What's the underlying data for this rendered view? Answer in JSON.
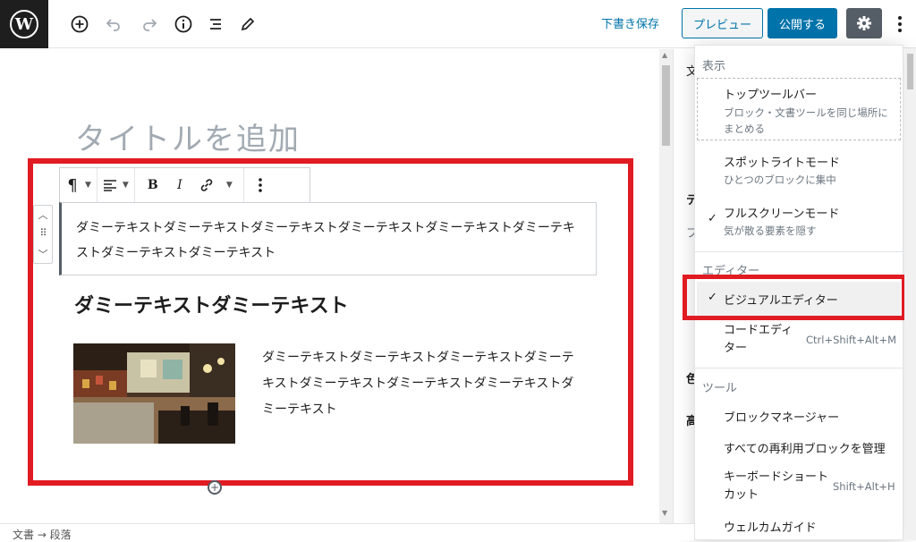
{
  "toolbar": {
    "save_draft": "下書き保存",
    "preview": "プレビュー",
    "publish": "公開する",
    "icons": [
      "wordpress-logo",
      "add-block-icon",
      "undo-icon",
      "redo-icon",
      "info-icon",
      "list-view-icon",
      "edit-tool-icon",
      "gear-icon",
      "more-vertical-icon"
    ]
  },
  "editor": {
    "title_placeholder": "タイトルを追加",
    "paragraph_text": "ダミーテキストダミーテキストダミーテキストダミーテキストダミーテキストダミーテキストダミーテキストダミーテキスト",
    "heading_text": "ダミーテキストダミーテキスト",
    "media_text": "ダミーテキストダミーテキストダミーテキストダミーテキストダミーテキストダミーテキストダミーテキストダミーテキスト",
    "block_toolbar": {
      "paragraph": "¶",
      "bold": "B",
      "italic": "I"
    }
  },
  "sidebar_fragments": {
    "tab_char": "文",
    "row1": "テ",
    "row2": "フ",
    "row3": "色",
    "row4": "高"
  },
  "menu": {
    "view_label": "表示",
    "top_toolbar_title": "トップツールバー",
    "top_toolbar_desc": "ブロック・文書ツールを同じ場所にまとめる",
    "spotlight_title": "スポットライトモード",
    "spotlight_desc": "ひとつのブロックに集中",
    "fullscreen_title": "フルスクリーンモード",
    "fullscreen_desc": "気が散る要素を隠す",
    "editor_label": "エディター",
    "visual_editor": "ビジュアルエディター",
    "code_editor": "コードエディター",
    "code_shortcut": "Ctrl+Shift+Alt+M",
    "tools_label": "ツール",
    "block_manager": "ブロックマネージャー",
    "manage_reusable": "すべての再利用ブロックを管理",
    "keyboard_shortcuts": "キーボードショートカット",
    "keyboard_shortcut_key": "Shift+Alt+H",
    "welcome_guide": "ウェルカムガイド"
  },
  "footer": {
    "breadcrumb": "文書 → 段落"
  },
  "colors": {
    "accent": "#0073aa",
    "highlight_red": "#e11b22",
    "dark": "#1e1e1e"
  }
}
